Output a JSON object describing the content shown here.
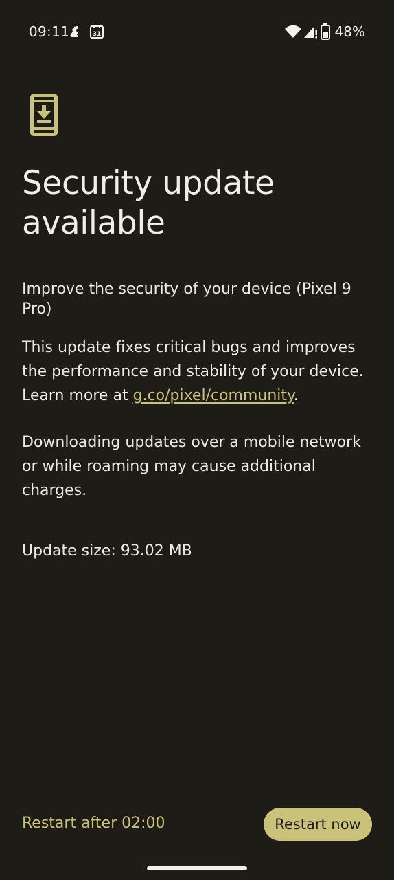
{
  "status_bar": {
    "time": "09:11",
    "calendar_day": "31",
    "battery_percent": "48%",
    "icons": [
      "notification-icon",
      "calendar-icon",
      "wifi-icon",
      "cellular-signal-icon",
      "battery-icon"
    ]
  },
  "update": {
    "title": "Security update available",
    "lead": "Improve the security of your device (Pixel 9 Pro)",
    "body_before_link": "This update fixes critical bugs and improves the performance and stability of your device. Learn more at ",
    "link_text": "g.co/pixel/community",
    "body_after_link": ".",
    "charges_note": "Downloading updates over a mobile network or while roaming may cause additional charges.",
    "size": "Update size: 93.02 MB"
  },
  "actions": {
    "restart_later": "Restart after 02:00",
    "restart_now": "Restart now"
  },
  "colors": {
    "background": "#1d1c16",
    "text": "#ecebe1",
    "accent": "#cbc27a"
  }
}
